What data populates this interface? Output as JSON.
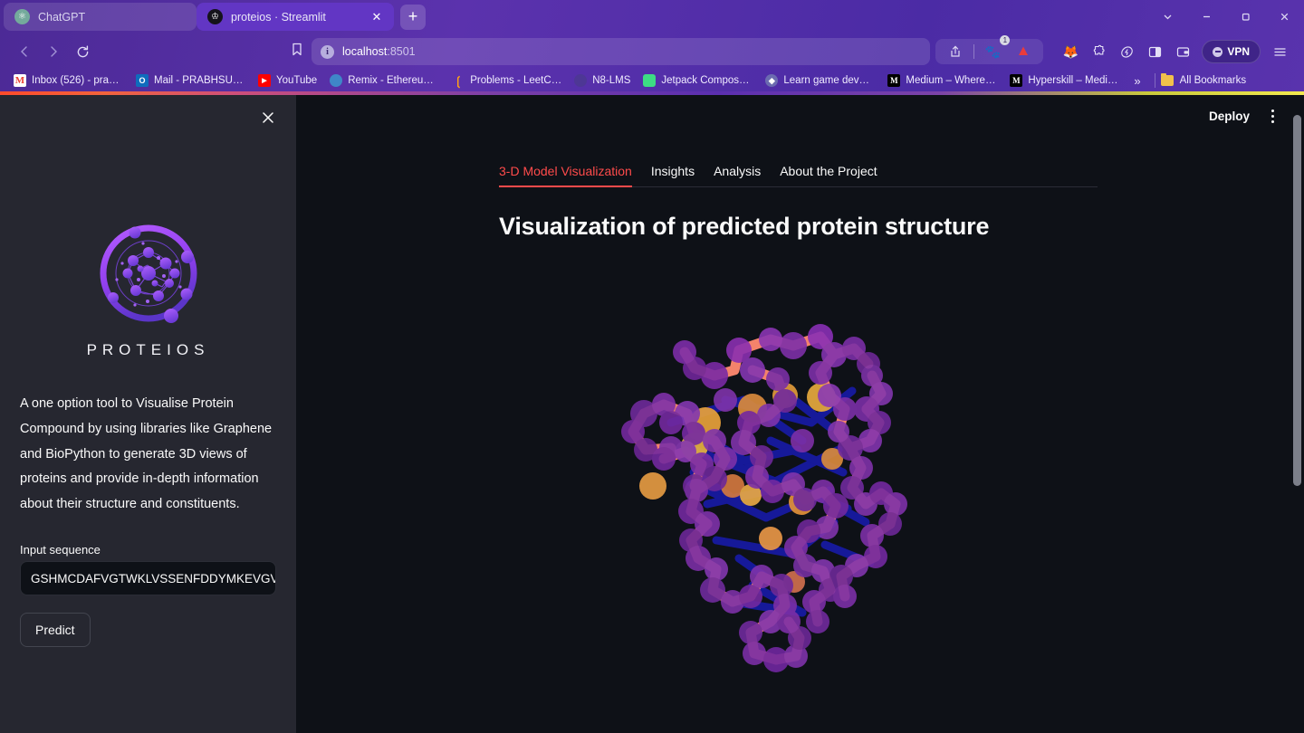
{
  "browser": {
    "tabs": [
      {
        "title": "ChatGPT",
        "favicon": "chatgpt-icon",
        "active": false
      },
      {
        "title": "proteios · Streamlit",
        "favicon": "streamlit-icon",
        "active": true
      }
    ],
    "new_tab_label": "+",
    "window_controls": [
      "chevron-down",
      "minimize",
      "maximize",
      "close"
    ],
    "url": "localhost",
    "url_port": ":8501",
    "nav": {
      "back": "‹",
      "forward": "›",
      "reload": "⟳"
    },
    "shield_badge": "1",
    "vpn_label": "VPN",
    "bookmarks": [
      {
        "label": "Inbox (526) - prabh...",
        "icon": "gmail-icon"
      },
      {
        "label": "Mail - PRABHSURA...",
        "icon": "outlook-icon"
      },
      {
        "label": "YouTube",
        "icon": "youtube-icon"
      },
      {
        "label": "Remix - Ethereum I...",
        "icon": "remix-icon"
      },
      {
        "label": "Problems - LeetCode",
        "icon": "leetcode-icon"
      },
      {
        "label": "N8-LMS",
        "icon": "n8lms-icon"
      },
      {
        "label": "Jetpack Compose f...",
        "icon": "android-icon"
      },
      {
        "label": "Learn game develo...",
        "icon": "unity-icon"
      },
      {
        "label": "Medium – Where g...",
        "icon": "medium-icon"
      },
      {
        "label": "Hyperskill – Medium",
        "icon": "medium-icon"
      }
    ],
    "bookmarks_overflow": "»",
    "all_bookmarks": "All Bookmarks"
  },
  "sidebar": {
    "close_label": "×",
    "logo_alt": "proteios-logo",
    "brand": "PROTEIOS",
    "description": "A one option tool to Visualise Protein Compound by using libraries like Graphene and BioPython to generate 3D views of proteins and provide in-depth information about their structure and constituents.",
    "input_label": "Input sequence",
    "input_value": "GSHMCDAFVGTWKLVSSENFDDYMKEVGVGF",
    "input_placeholder": "Input sequence",
    "predict_label": "Predict"
  },
  "main": {
    "deploy_label": "Deploy",
    "menu_label": "⋮",
    "tabs": [
      {
        "label": "3-D Model Visualization",
        "selected": true
      },
      {
        "label": "Insights",
        "selected": false
      },
      {
        "label": "Analysis",
        "selected": false
      },
      {
        "label": "About the Project",
        "selected": false
      }
    ],
    "title": "Visualization of predicted protein structure"
  },
  "colors": {
    "accent_red": "#ff4b4b",
    "app_bg": "#0e1117",
    "sidebar_bg": "#262730",
    "browser_purple": "#5b32ad",
    "brand_purple": "#9b4dff",
    "protein_salmon": "#f4836b",
    "protein_blue": "#171a9e",
    "protein_purple": "#7d2fa8",
    "protein_orange": "#e8a13a"
  }
}
